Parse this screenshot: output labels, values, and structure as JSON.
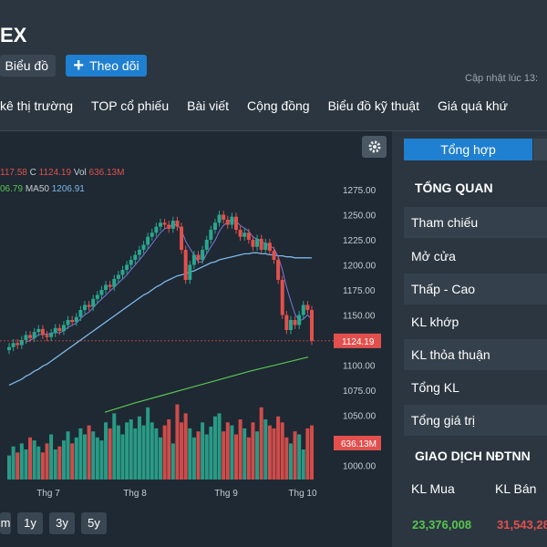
{
  "header": {
    "title": "EX",
    "chart_button": "Biểu đồ",
    "follow_button": "Theo dõi",
    "updated": "Cập nhật lúc 13:"
  },
  "nav": [
    "kê thị trường",
    "TOP cổ phiếu",
    "Bài viết",
    "Cộng đồng",
    "Biểu đồ kỹ thuật",
    "Giá quá khứ"
  ],
  "chart": {
    "legend1": {
      "prefix": "117.58",
      "c_label": "C",
      "c_value": "1124.19",
      "vol_label": "Vol",
      "vol_value": "636.13M"
    },
    "legend2": {
      "ma_prev_value": "06.79",
      "ma50_label": "MA50",
      "ma50_value": "1206.91"
    },
    "price_ticks": [
      "1275.00",
      "1250.00",
      "1225.00",
      "1200.00",
      "1175.00",
      "1150.00",
      "1125.00",
      "1100.00",
      "1075.00",
      "1050.00",
      "1025.00",
      "1000.00"
    ],
    "current_price_label": "1124.19",
    "volume_label": "636.13M",
    "months": [
      "Thg 7",
      "Thg 8",
      "Thg 9",
      "Thg 10"
    ],
    "range_buttons": [
      "m",
      "1y",
      "3y",
      "5y"
    ]
  },
  "chart_data": {
    "type": "candlestick",
    "y_price_range": [
      1000,
      1275
    ],
    "x_labels": [
      "Thg 7",
      "Thg 8",
      "Thg 9",
      "Thg 10"
    ],
    "close": [
      1118,
      1122,
      1120,
      1125,
      1130,
      1127,
      1133,
      1136,
      1130,
      1128,
      1132,
      1137,
      1134,
      1140,
      1145,
      1143,
      1148,
      1155,
      1160,
      1158,
      1166,
      1170,
      1175,
      1180,
      1178,
      1186,
      1190,
      1195,
      1200,
      1205,
      1210,
      1215,
      1220,
      1228,
      1232,
      1238,
      1242,
      1240,
      1236,
      1244,
      1238,
      1215,
      1185,
      1200,
      1210,
      1205,
      1215,
      1225,
      1235,
      1242,
      1250,
      1245,
      1240,
      1248,
      1235,
      1228,
      1232,
      1225,
      1218,
      1226,
      1215,
      1222,
      1214,
      1205,
      1185,
      1150,
      1135,
      1145,
      1140,
      1150,
      1160,
      1155,
      1124.19
    ],
    "ma50": [
      1080,
      1082,
      1084,
      1086,
      1089,
      1091,
      1094,
      1096,
      1099,
      1101,
      1104,
      1107,
      1110,
      1113,
      1116,
      1119,
      1122,
      1125,
      1128,
      1131,
      1134,
      1137,
      1140,
      1143,
      1146,
      1149,
      1152,
      1155,
      1158,
      1161,
      1164,
      1167,
      1170,
      1172,
      1175,
      1178,
      1180,
      1183,
      1185,
      1187,
      1189,
      1190,
      1191,
      1193,
      1194,
      1196,
      1198,
      1200,
      1202,
      1203,
      1205,
      1206,
      1207,
      1208,
      1209,
      1210,
      1211,
      1211,
      1212,
      1212,
      1211,
      1211,
      1210,
      1210,
      1209,
      1209,
      1208,
      1208,
      1207,
      1207,
      1207,
      1207,
      1206.91
    ],
    "volume": [
      40,
      55,
      45,
      60,
      50,
      70,
      65,
      55,
      45,
      60,
      75,
      50,
      55,
      65,
      80,
      60,
      70,
      85,
      75,
      90,
      80,
      70,
      65,
      95,
      85,
      110,
      90,
      75,
      95,
      100,
      85,
      105,
      90,
      120,
      95,
      85,
      70,
      90,
      100,
      60,
      125,
      95,
      110,
      85,
      70,
      80,
      95,
      75,
      88,
      105,
      110,
      80,
      95,
      90,
      75,
      100,
      85,
      70,
      95,
      80,
      120,
      100,
      90,
      85,
      105,
      95,
      70,
      60,
      80,
      75,
      50,
      85,
      90
    ],
    "ma200_points": [
      1053,
      1062,
      1070,
      1078,
      1086,
      1094,
      1101,
      1108
    ]
  },
  "panel": {
    "tabs": [
      "Tổng hợp"
    ],
    "overview_title": "TỔNG QUAN",
    "rows": [
      "Tham chiếu",
      "Mở cửa",
      "Thấp - Cao",
      "KL khớp",
      "KL thỏa thuận",
      "Tổng KL",
      "Tổng giá trị"
    ],
    "foreign_title": "GIAO DỊCH NĐTNN",
    "buy_label": "KL Mua",
    "sell_label": "KL Bán",
    "buy_value": "23,376,008",
    "sell_value": "31,543,28"
  },
  "colors": {
    "up": "#2aa68f",
    "down": "#e2504d",
    "ma50": "#7fb7e8",
    "ma_short": "#7b79d8",
    "ma200": "#5ac451",
    "accent": "#1f7fd0"
  }
}
